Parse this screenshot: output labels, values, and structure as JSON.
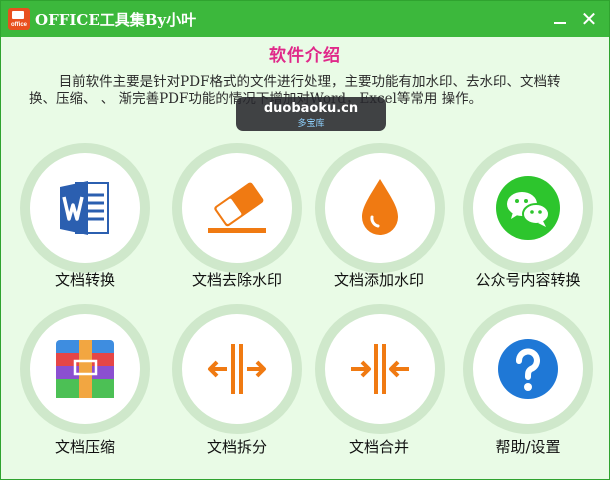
{
  "window": {
    "title": "OFFICE工具集By小叶",
    "logo_text": "office",
    "minimize_symbol": "",
    "close_symbol": "✕"
  },
  "intro": {
    "heading": "软件介绍",
    "body": "目前软件主要是针对PDF格式的文件进行处理，主要功能有加水印、去水印、文档转换、压缩、 、 渐完善PDF功能的情况下增加对Word，Excel等常用 操作。"
  },
  "overlay": {
    "site": "duobaoku.cn",
    "sub": "多宝库"
  },
  "tools": [
    {
      "label": "文档转换",
      "icon": "word-doc-icon"
    },
    {
      "label": "文档去除水印",
      "icon": "eraser-icon"
    },
    {
      "label": "文档添加水印",
      "icon": "water-drop-icon"
    },
    {
      "label": "公众号内容转换",
      "icon": "wechat-icon"
    },
    {
      "label": "文档压缩",
      "icon": "archive-box-icon"
    },
    {
      "label": "文档拆分",
      "icon": "split-arrows-icon"
    },
    {
      "label": "文档合并",
      "icon": "merge-arrows-icon"
    },
    {
      "label": "帮助/设置",
      "icon": "help-icon"
    }
  ],
  "colors": {
    "titlebar": "#3cb83c",
    "background": "#e9fbe6",
    "heading": "#e0298a",
    "icon_orange": "#f07a12",
    "word_blue": "#2b5fb0",
    "wechat_green": "#2dc52d",
    "help_blue": "#1f78d6"
  }
}
